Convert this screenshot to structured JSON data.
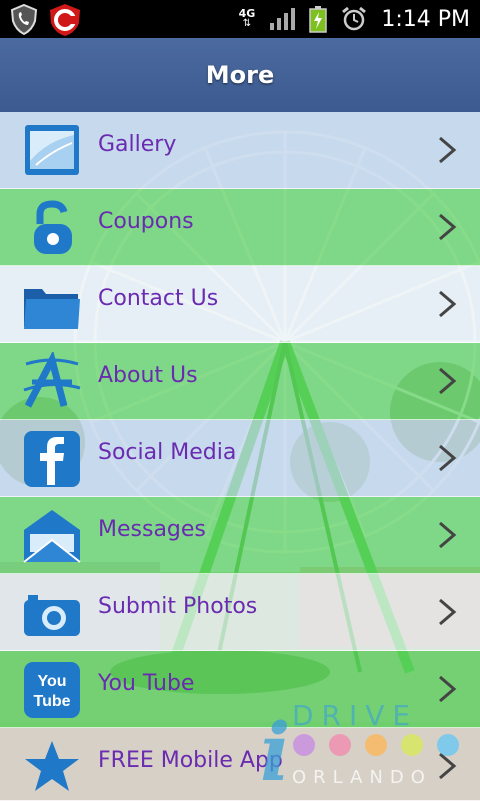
{
  "status_bar": {
    "network_label": "4G",
    "time": "1:14 PM",
    "icons": [
      "shield-phone-icon",
      "app-logo-icon",
      "network-transfer-icon",
      "signal-strength-icon",
      "battery-charging-icon",
      "alarm-icon"
    ]
  },
  "title_bar": {
    "title": "More"
  },
  "menu": {
    "items": [
      {
        "label": "Gallery",
        "icon": "gallery-icon"
      },
      {
        "label": "Coupons",
        "icon": "coupon-lock-icon"
      },
      {
        "label": "Contact Us",
        "icon": "folder-icon"
      },
      {
        "label": "About Us",
        "icon": "about-a-icon"
      },
      {
        "label": "Social Media",
        "icon": "facebook-icon"
      },
      {
        "label": "Messages",
        "icon": "envelope-icon"
      },
      {
        "label": "Submit Photos",
        "icon": "camera-icon"
      },
      {
        "label": "You Tube",
        "icon": "youtube-icon"
      },
      {
        "label": "FREE Mobile App",
        "icon": "star-icon"
      }
    ]
  },
  "watermark": {
    "line1": "DRIVE",
    "line2": "ORLANDO",
    "letter": "i"
  },
  "colors": {
    "title_bar": "#4b6aa0",
    "label_text": "#6a2bb0",
    "row_green": "#60d260",
    "row_blue": "#c4d6ec",
    "icon_blue": "#1f78c8"
  }
}
